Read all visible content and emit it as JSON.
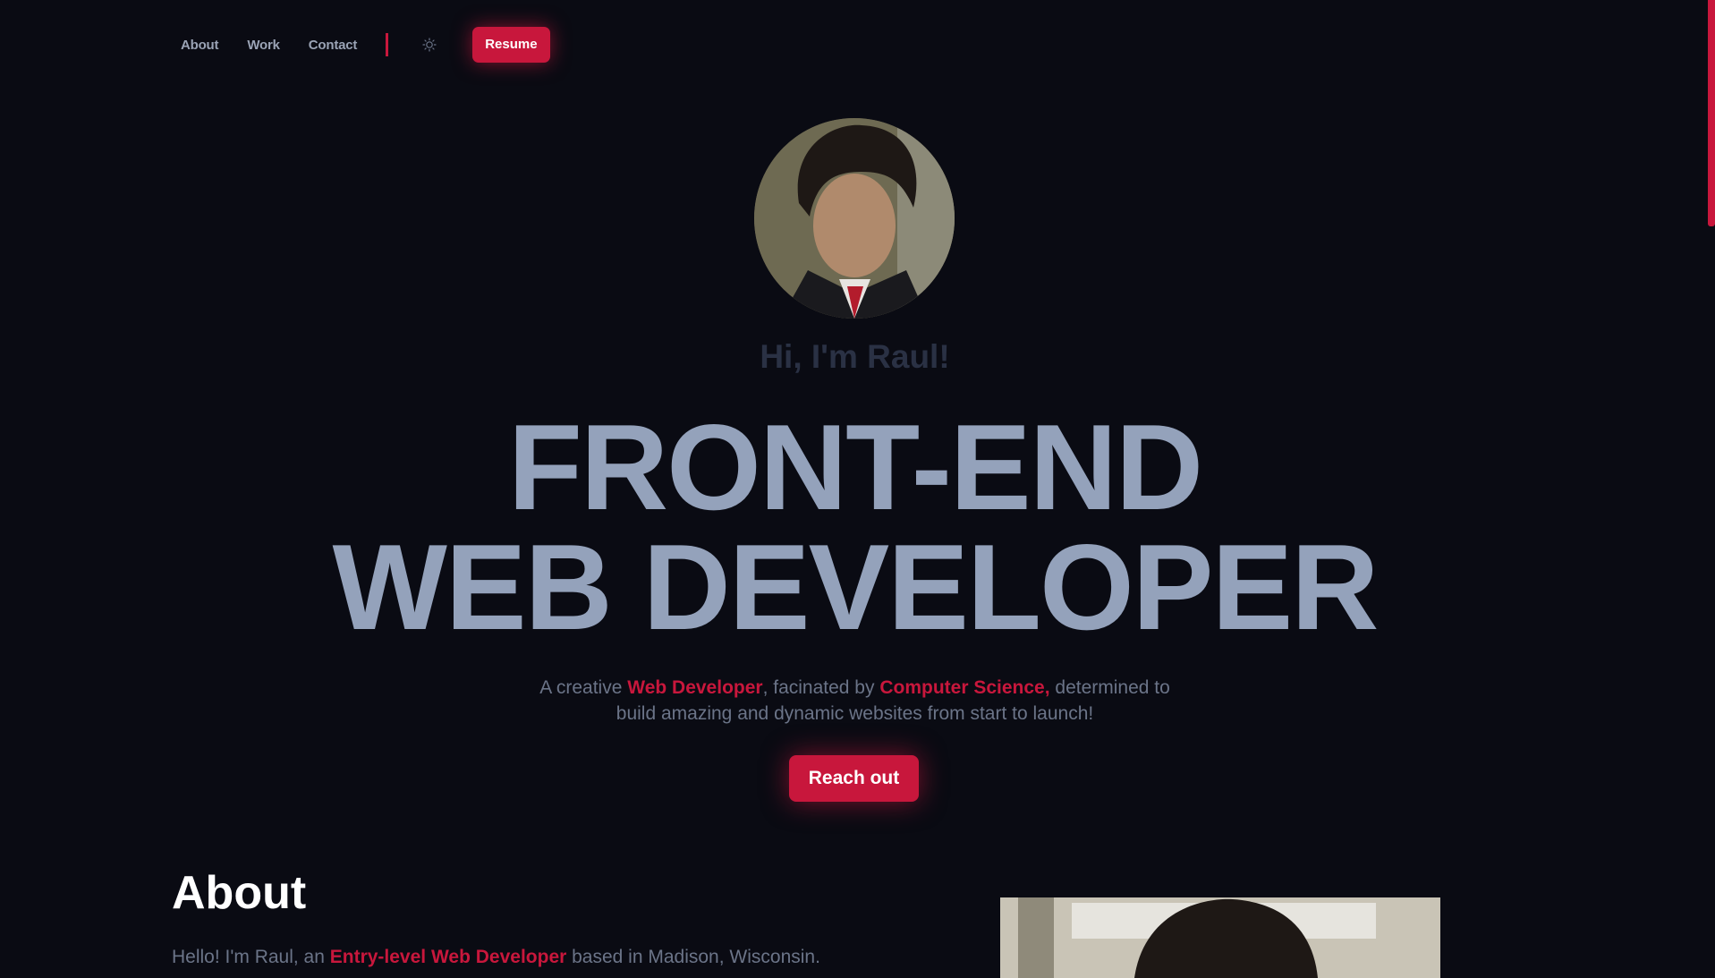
{
  "nav": {
    "items": [
      {
        "label": "About"
      },
      {
        "label": "Work"
      },
      {
        "label": "Contact"
      }
    ],
    "theme_icon": "sun-icon",
    "resume_label": "Resume"
  },
  "hero": {
    "greeting": "Hi, I'm Raul!",
    "headline_line1": "FRONT-END",
    "headline_line2": "WEB DEVELOPER",
    "tagline": {
      "part1": "A creative ",
      "highlight1": "Web Developer",
      "part2": ", facinated by ",
      "highlight2": "Computer Science,",
      "part3": " determined to",
      "part4": "build amazing and dynamic websites from start to launch!"
    },
    "cta_label": "Reach out"
  },
  "about": {
    "title": "About",
    "intro_part1": "Hello! I'm Raul, an ",
    "intro_highlight": "Entry-level Web Developer",
    "intro_part2": " based in Madison, Wisconsin."
  },
  "colors": {
    "background": "#0a0b13",
    "accent": "#c8173c",
    "headline": "#94a2bb"
  }
}
